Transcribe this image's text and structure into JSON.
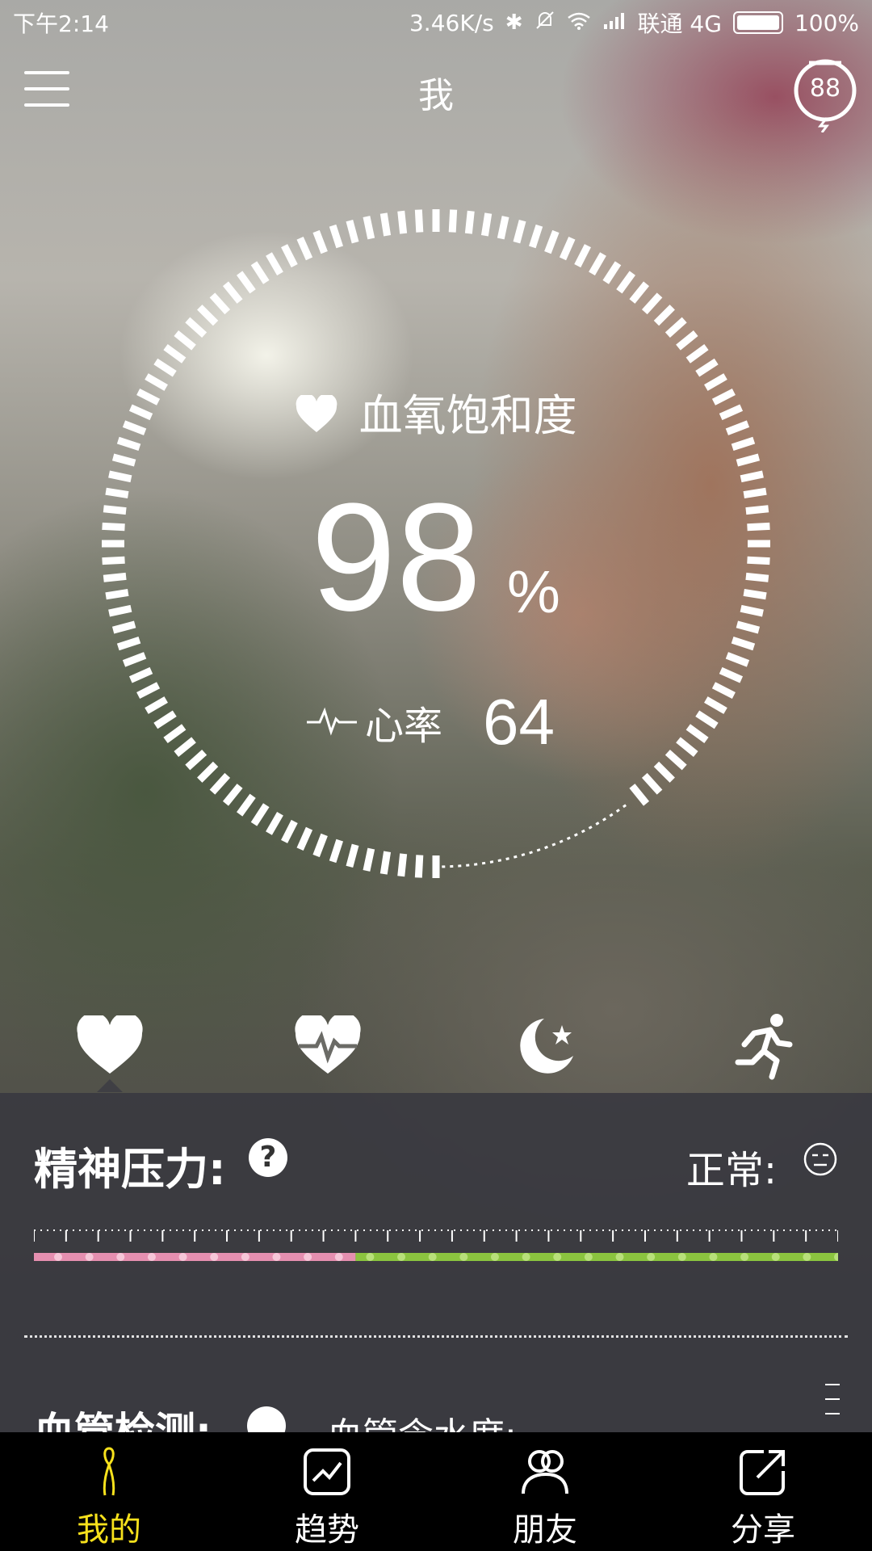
{
  "status_bar": {
    "time": "下午2:14",
    "speed": "3.46K/s",
    "carrier": "联通 4G",
    "battery": "100%"
  },
  "header": {
    "title": "我",
    "device_badge": "88"
  },
  "main_metric": {
    "title": "血氧饱和度",
    "value": "98",
    "unit": "%",
    "ring_progress": 0.9,
    "heart_rate_label": "心率",
    "heart_rate_value": "64"
  },
  "category_icons": [
    "heart-icon",
    "heartbeat-icon",
    "moon-star-icon",
    "running-icon"
  ],
  "stress_panel": {
    "title": "精神压力:",
    "status_label": "正常:",
    "scale_low_color": "#e58fb0",
    "scale_normal_color": "#8bc43f",
    "scale_split": 0.4
  },
  "vessel_panel": {
    "title": "血管检测:",
    "subtitle": "血管含水度:"
  },
  "bottom_nav": [
    {
      "label": "我的",
      "icon": "person-icon",
      "active": true
    },
    {
      "label": "趋势",
      "icon": "trend-icon",
      "active": false
    },
    {
      "label": "朋友",
      "icon": "friends-icon",
      "active": false
    },
    {
      "label": "分享",
      "icon": "share-icon",
      "active": false
    }
  ],
  "colors": {
    "accent": "#f7e11c",
    "panel_bg": "#3a3a40"
  }
}
